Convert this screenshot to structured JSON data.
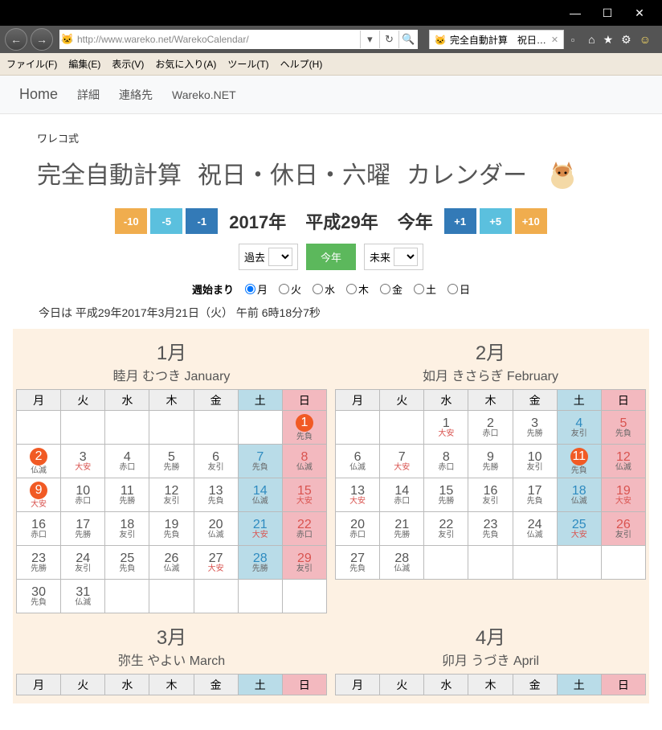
{
  "window": {
    "min": "—",
    "max": "☐",
    "close": "✕"
  },
  "url": "http://www.wareko.net/WarekoCalendar/",
  "tab": {
    "title": "完全自動計算　祝日…"
  },
  "menubar": {
    "file": "ファイル(F)",
    "edit": "編集(E)",
    "view": "表示(V)",
    "fav": "お気に入り(A)",
    "tool": "ツール(T)",
    "help": "ヘルプ(H)"
  },
  "appnav": {
    "home": "Home",
    "detail": "詳細",
    "contact": "連絡先",
    "wareko": "Wareko.NET"
  },
  "page": {
    "small": "ワレコ式",
    "title_a": "完全自動計算",
    "title_b": "祝日・休日・六曜",
    "title_c": "カレンダー"
  },
  "year": {
    "m10": "-10",
    "m5": "-5",
    "m1": "-1",
    "west": "2017年",
    "era": "平成29年",
    "now": "今年",
    "p1": "+1",
    "p5": "+5",
    "p10": "+10"
  },
  "sel": {
    "past": "過去",
    "now": "今年",
    "future": "未来"
  },
  "week": {
    "label": "週始まり",
    "mon": "月",
    "tue": "火",
    "wed": "水",
    "thu": "木",
    "fri": "金",
    "sat": "土",
    "sun": "日"
  },
  "today": "今日は 平成29年2017年3月21日（火）  午前 6時18分7秒",
  "dow": {
    "mon": "月",
    "tue": "火",
    "wed": "水",
    "thu": "木",
    "fri": "金",
    "sat": "土",
    "sun": "日"
  },
  "months": [
    {
      "title": "1月",
      "sub": "睦月  むつき  January",
      "weeks": [
        [
          null,
          null,
          null,
          null,
          null,
          null,
          {
            "d": "1",
            "r": "先負",
            "sun": true,
            "hol": true
          }
        ],
        [
          {
            "d": "2",
            "r": "仏滅",
            "hol": true
          },
          {
            "d": "3",
            "r": "大安",
            "red": true
          },
          {
            "d": "4",
            "r": "赤口"
          },
          {
            "d": "5",
            "r": "先勝"
          },
          {
            "d": "6",
            "r": "友引"
          },
          {
            "d": "7",
            "r": "先負",
            "sat": true
          },
          {
            "d": "8",
            "r": "仏滅",
            "sun": true
          }
        ],
        [
          {
            "d": "9",
            "r": "大安",
            "hol": true,
            "red": true
          },
          {
            "d": "10",
            "r": "赤口"
          },
          {
            "d": "11",
            "r": "先勝"
          },
          {
            "d": "12",
            "r": "友引"
          },
          {
            "d": "13",
            "r": "先負"
          },
          {
            "d": "14",
            "r": "仏滅",
            "sat": true
          },
          {
            "d": "15",
            "r": "大安",
            "sun": true,
            "red": true
          }
        ],
        [
          {
            "d": "16",
            "r": "赤口"
          },
          {
            "d": "17",
            "r": "先勝"
          },
          {
            "d": "18",
            "r": "友引"
          },
          {
            "d": "19",
            "r": "先負"
          },
          {
            "d": "20",
            "r": "仏滅"
          },
          {
            "d": "21",
            "r": "大安",
            "sat": true,
            "red": true
          },
          {
            "d": "22",
            "r": "赤口",
            "sun": true
          }
        ],
        [
          {
            "d": "23",
            "r": "先勝"
          },
          {
            "d": "24",
            "r": "友引"
          },
          {
            "d": "25",
            "r": "先負"
          },
          {
            "d": "26",
            "r": "仏滅"
          },
          {
            "d": "27",
            "r": "大安",
            "red": true
          },
          {
            "d": "28",
            "r": "先勝",
            "sat": true
          },
          {
            "d": "29",
            "r": "友引",
            "sun": true
          }
        ],
        [
          {
            "d": "30",
            "r": "先負"
          },
          {
            "d": "31",
            "r": "仏滅"
          },
          null,
          null,
          null,
          null,
          null
        ]
      ]
    },
    {
      "title": "2月",
      "sub": "如月  きさらぎ  February",
      "weeks": [
        [
          null,
          null,
          {
            "d": "1",
            "r": "大安",
            "red": true
          },
          {
            "d": "2",
            "r": "赤口"
          },
          {
            "d": "3",
            "r": "先勝"
          },
          {
            "d": "4",
            "r": "友引",
            "sat": true
          },
          {
            "d": "5",
            "r": "先負",
            "sun": true
          }
        ],
        [
          {
            "d": "6",
            "r": "仏滅"
          },
          {
            "d": "7",
            "r": "大安",
            "red": true
          },
          {
            "d": "8",
            "r": "赤口"
          },
          {
            "d": "9",
            "r": "先勝"
          },
          {
            "d": "10",
            "r": "友引"
          },
          {
            "d": "11",
            "r": "先負",
            "sat": true,
            "hol": true
          },
          {
            "d": "12",
            "r": "仏滅",
            "sun": true
          }
        ],
        [
          {
            "d": "13",
            "r": "大安",
            "red": true
          },
          {
            "d": "14",
            "r": "赤口"
          },
          {
            "d": "15",
            "r": "先勝"
          },
          {
            "d": "16",
            "r": "友引"
          },
          {
            "d": "17",
            "r": "先負"
          },
          {
            "d": "18",
            "r": "仏滅",
            "sat": true
          },
          {
            "d": "19",
            "r": "大安",
            "sun": true,
            "red": true
          }
        ],
        [
          {
            "d": "20",
            "r": "赤口"
          },
          {
            "d": "21",
            "r": "先勝"
          },
          {
            "d": "22",
            "r": "友引"
          },
          {
            "d": "23",
            "r": "先負"
          },
          {
            "d": "24",
            "r": "仏滅"
          },
          {
            "d": "25",
            "r": "大安",
            "sat": true,
            "red": true
          },
          {
            "d": "26",
            "r": "友引",
            "sun": true
          }
        ],
        [
          {
            "d": "27",
            "r": "先負"
          },
          {
            "d": "28",
            "r": "仏滅"
          },
          null,
          null,
          null,
          null,
          null
        ]
      ]
    },
    {
      "title": "3月",
      "sub": "弥生  やよい  March",
      "weeks": []
    },
    {
      "title": "4月",
      "sub": "卯月  うづき  April",
      "weeks": []
    }
  ]
}
